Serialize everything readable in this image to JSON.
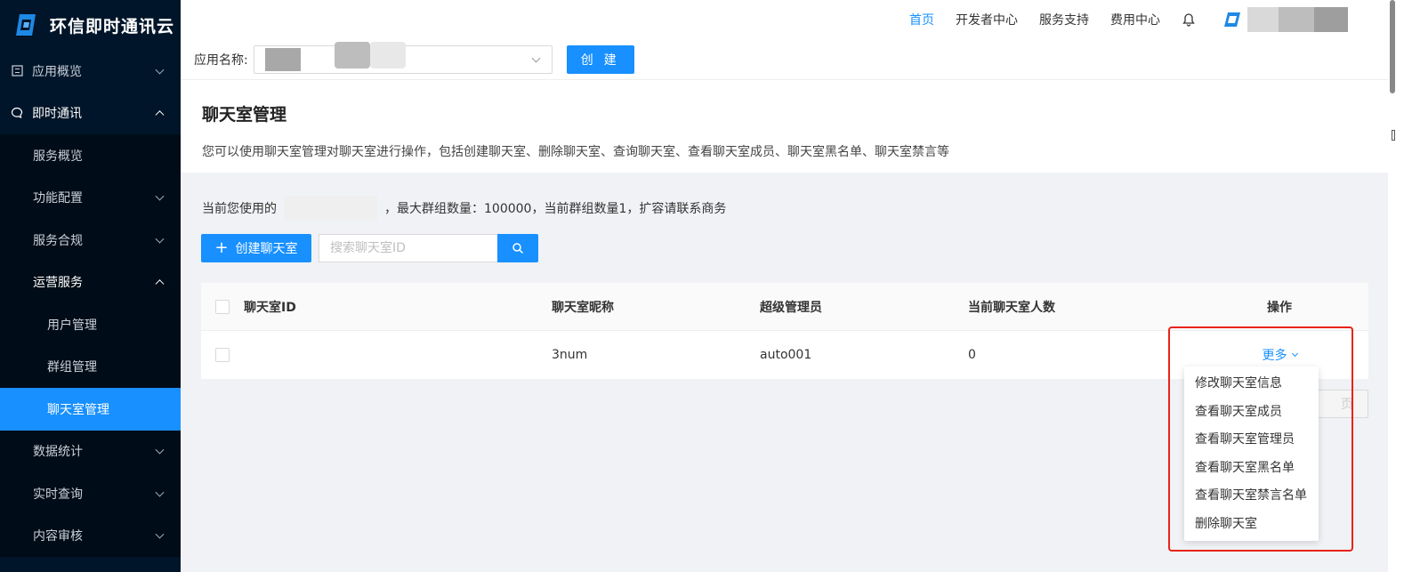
{
  "brand": {
    "name": "环信即时通讯云"
  },
  "sidebar": {
    "items": [
      {
        "label": "应用概览",
        "level": 1,
        "icon": "overview-icon",
        "chevron": "down"
      },
      {
        "label": "即时通讯",
        "level": 1,
        "icon": "chat-icon",
        "chevron": "up"
      },
      {
        "label": "服务概览",
        "level": 2
      },
      {
        "label": "功能配置",
        "level": 2,
        "chevron": "down"
      },
      {
        "label": "服务合规",
        "level": 2,
        "chevron": "down"
      },
      {
        "label": "运营服务",
        "level": 2,
        "chevron": "up"
      },
      {
        "label": "用户管理",
        "level": 3
      },
      {
        "label": "群组管理",
        "level": 3
      },
      {
        "label": "聊天室管理",
        "level": 3,
        "active": true
      },
      {
        "label": "数据统计",
        "level": 2,
        "chevron": "down"
      },
      {
        "label": "实时查询",
        "level": 2,
        "chevron": "down"
      },
      {
        "label": "内容审核",
        "level": 2,
        "chevron": "down"
      }
    ]
  },
  "topnav": {
    "links": [
      {
        "label": "首页",
        "active": true
      },
      {
        "label": "开发者中心"
      },
      {
        "label": "服务支持"
      },
      {
        "label": "费用中心"
      }
    ]
  },
  "appbar": {
    "label": "应用名称:",
    "create_label": "创 建"
  },
  "page": {
    "title": "聊天室管理",
    "description": "您可以使用聊天室管理对聊天室进行操作，包括创建聊天室、删除聊天室、查询聊天室、查看聊天室成员、聊天室黑名单、聊天室禁言等"
  },
  "info": {
    "prefix": "当前您使用的",
    "suffix": "，最大群组数量：100000，当前群组数量1，扩容请联系商务"
  },
  "toolbar": {
    "create_label": "创建聊天室",
    "search_placeholder": "搜索聊天室ID"
  },
  "table": {
    "headers": [
      "聊天室ID",
      "聊天室昵称",
      "超级管理员",
      "当前聊天室人数",
      "操作"
    ],
    "rows": [
      {
        "id": "",
        "name": "3num",
        "admin": "auto001",
        "count": "0",
        "action": "更多"
      }
    ]
  },
  "pager": {
    "next_partial": "页"
  },
  "dropdown": {
    "items": [
      "修改聊天室信息",
      "查看聊天室成员",
      "查看聊天室管理员",
      "查看聊天室黑名单",
      "查看聊天室禁言名单",
      "删除聊天室"
    ]
  },
  "colors": {
    "primary": "#1890ff",
    "sidebar": "#001529",
    "highlight": "#e8231a"
  }
}
